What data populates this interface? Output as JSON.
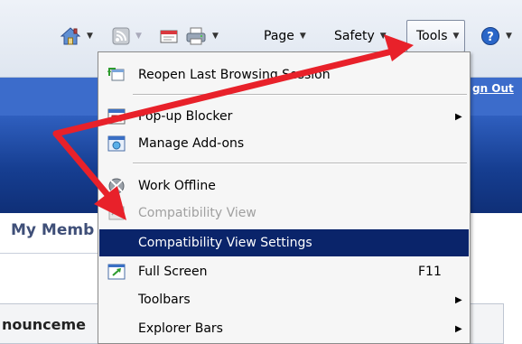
{
  "toolbar": {
    "page_label": "Page",
    "safety_label": "Safety",
    "tools_label": "Tools"
  },
  "site": {
    "sign_out": "gn Out",
    "heading": "My Memb",
    "announcements": "nounceme"
  },
  "menu": {
    "items": [
      {
        "label": "Reopen Last Browsing Session",
        "icon": "reopen-session-icon"
      },
      {
        "label": "Pop-up Blocker",
        "icon": "popup-blocker-icon",
        "submenu": true
      },
      {
        "label": "Manage Add-ons",
        "icon": "manage-addons-icon"
      },
      {
        "label": "Work Offline",
        "icon": "work-offline-icon"
      },
      {
        "label": "Compatibility View",
        "icon": "compatibility-view-icon",
        "disabled": true
      },
      {
        "label": "Compatibility View Settings",
        "selected": true
      },
      {
        "label": "Full Screen",
        "icon": "full-screen-icon",
        "accelerator": "F11"
      },
      {
        "label": "Toolbars",
        "submenu": true
      },
      {
        "label": "Explorer Bars",
        "submenu": true
      }
    ]
  },
  "colors": {
    "menu_highlight": "#0a246a",
    "annotation_arrow": "#e8212a",
    "site_band": "#1b4599"
  }
}
